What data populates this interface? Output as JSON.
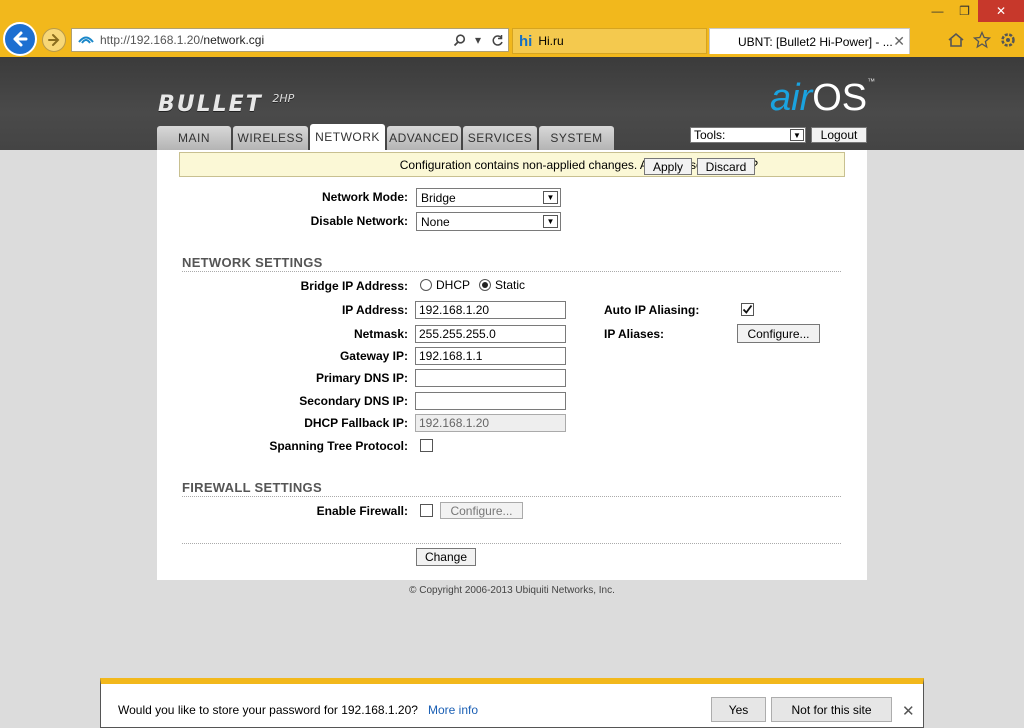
{
  "browser": {
    "url_host": "http://192.168.1.20/",
    "url_path": "network.cgi",
    "tabs": [
      {
        "label": "Hi.ru",
        "active": false
      },
      {
        "label": "UBNT: [Bullet2 Hi-Power] - ...",
        "active": true
      }
    ]
  },
  "header": {
    "product": "BULLET",
    "product_suffix": "2HP",
    "brand_air": "air",
    "brand_os": "OS",
    "brand_tm": "™",
    "nav": [
      "MAIN",
      "WIRELESS",
      "NETWORK",
      "ADVANCED",
      "SERVICES",
      "SYSTEM"
    ],
    "active_nav": "NETWORK",
    "tools_label": "Tools:",
    "logout_label": "Logout"
  },
  "notice": {
    "text": "Configuration contains non-applied changes. Apply these changes?",
    "apply_label": "Apply",
    "discard_label": "Discard"
  },
  "form": {
    "network_mode_label": "Network Mode:",
    "network_mode_value": "Bridge",
    "disable_network_label": "Disable Network:",
    "disable_network_value": "None",
    "network_settings_title": "NETWORK SETTINGS",
    "bridge_ip_label": "Bridge IP Address:",
    "bridge_ip_options": [
      "DHCP",
      "Static"
    ],
    "bridge_ip_selected": "Static",
    "ip_address_label": "IP Address:",
    "ip_address_value": "192.168.1.20",
    "netmask_label": "Netmask:",
    "netmask_value": "255.255.255.0",
    "gateway_label": "Gateway IP:",
    "gateway_value": "192.168.1.1",
    "primary_dns_label": "Primary DNS IP:",
    "primary_dns_value": "",
    "secondary_dns_label": "Secondary DNS IP:",
    "secondary_dns_value": "",
    "dhcp_fallback_label": "DHCP Fallback IP:",
    "dhcp_fallback_value": "192.168.1.20",
    "stp_label": "Spanning Tree Protocol:",
    "stp_checked": false,
    "auto_ip_aliasing_label": "Auto IP Aliasing:",
    "auto_ip_aliasing_checked": true,
    "ip_aliases_label": "IP Aliases:",
    "ip_aliases_button": "Configure...",
    "firewall_title": "FIREWALL SETTINGS",
    "enable_firewall_label": "Enable Firewall:",
    "enable_firewall_checked": false,
    "firewall_configure_button": "Configure...",
    "change_button": "Change"
  },
  "copyright": "© Copyright 2006-2013 Ubiquiti Networks, Inc.",
  "password_bar": {
    "message": "Would you like to store your password for 192.168.1.20?",
    "more_info": "More info",
    "yes_label": "Yes",
    "not_for_site_label": "Not for this site"
  },
  "colors": {
    "chrome_yellow": "#f2b81c",
    "back_blue": "#1d6fd1",
    "airos_blue": "#1aa3e0",
    "notice_bg": "#fbf8d6"
  }
}
